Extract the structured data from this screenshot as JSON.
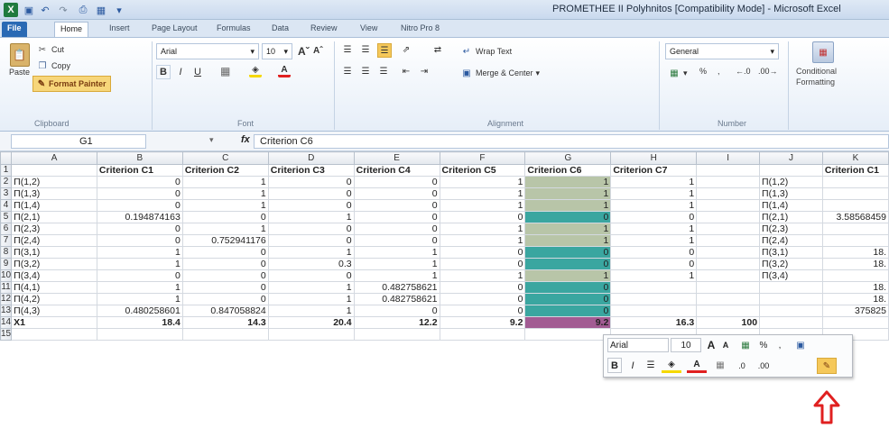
{
  "titlebar": {
    "title": "PROMETHEE II Polyhnitos  [Compatibility Mode] - Microsoft Excel",
    "excel_icon": "excel-icon",
    "save_icon": "save-icon",
    "undo_icon": "undo-icon",
    "redo_icon": "redo-icon",
    "print_icon": "print-icon"
  },
  "tabs": [
    "File",
    "Home",
    "Insert",
    "Page Layout",
    "Formulas",
    "Data",
    "Review",
    "View",
    "Nitro Pro 8"
  ],
  "ribbon": {
    "clipboard": {
      "paste": "Paste",
      "cut": "Cut",
      "copy": "Copy",
      "format_painter": "Format Painter",
      "label": "Clipboard"
    },
    "font": {
      "name": "Arial",
      "size": "10",
      "label": "Font",
      "bold": "B",
      "italic": "I",
      "underline": "U"
    },
    "alignment": {
      "wrap_text": "Wrap Text",
      "merge_center": "Merge & Center",
      "label": "Alignment"
    },
    "number": {
      "format": "General",
      "percent": "%",
      "label": "Number"
    },
    "styles": {
      "conditional": "Conditional",
      "formatting": "Formatting"
    }
  },
  "formula_bar": {
    "cell_ref": "G1",
    "fx": "fx",
    "content": "Criterion C6"
  },
  "grid": {
    "columns": [
      "A",
      "B",
      "C",
      "D",
      "E",
      "F",
      "G",
      "H",
      "I",
      "J",
      "K"
    ],
    "rows": [
      [
        "",
        "Criterion C1",
        "Criterion C2",
        "Criterion C3",
        "Criterion C4",
        "Criterion C5",
        "Criterion C6",
        "Criterion C7",
        "",
        "",
        "Criterion C1"
      ],
      [
        "Π(1,2)",
        "0",
        "1",
        "0",
        "0",
        "1",
        "1",
        "1",
        "",
        "Π(1,2)",
        ""
      ],
      [
        "Π(1,3)",
        "0",
        "1",
        "0",
        "0",
        "1",
        "1",
        "1",
        "",
        "Π(1,3)",
        ""
      ],
      [
        "Π(1,4)",
        "0",
        "1",
        "0",
        "0",
        "1",
        "1",
        "1",
        "",
        "Π(1,4)",
        ""
      ],
      [
        "Π(2,1)",
        "0.194874163",
        "0",
        "1",
        "0",
        "0",
        "0",
        "0",
        "",
        "Π(2,1)",
        "3.58568459"
      ],
      [
        "Π(2,3)",
        "0",
        "1",
        "0",
        "0",
        "1",
        "1",
        "1",
        "",
        "Π(2,3)",
        ""
      ],
      [
        "Π(2,4)",
        "0",
        "0.752941176",
        "0",
        "0",
        "1",
        "1",
        "1",
        "",
        "Π(2,4)",
        ""
      ],
      [
        "Π(3,1)",
        "1",
        "0",
        "1",
        "1",
        "0",
        "0",
        "0",
        "",
        "Π(3,1)",
        "18."
      ],
      [
        "Π(3,2)",
        "1",
        "0",
        "0.3",
        "1",
        "0",
        "0",
        "0",
        "",
        "Π(3,2)",
        "18."
      ],
      [
        "Π(3,4)",
        "0",
        "0",
        "0",
        "1",
        "1",
        "1",
        "1",
        "",
        "Π(3,4)",
        ""
      ],
      [
        "Π(4,1)",
        "1",
        "0",
        "1",
        "0.482758621",
        "0",
        "0",
        "",
        "",
        "",
        "18."
      ],
      [
        "Π(4,2)",
        "1",
        "0",
        "1",
        "0.482758621",
        "0",
        "0",
        "",
        "",
        "",
        "18."
      ],
      [
        "Π(4,3)",
        "0.480258601",
        "0.847058824",
        "1",
        "0",
        "0",
        "0",
        "",
        "",
        "",
        "375825"
      ],
      [
        "X1",
        "18.4",
        "14.3",
        "20.4",
        "12.2",
        "9.2",
        "9.2",
        "16.3",
        "100",
        "",
        ""
      ],
      [
        "",
        "",
        "",
        "",
        "",
        "",
        "",
        "",
        "",
        "",
        ""
      ]
    ],
    "row_numbers": [
      "1",
      "2",
      "3",
      "4",
      "5",
      "6",
      "7",
      "8",
      "9",
      "10",
      "11",
      "12",
      "13",
      "14",
      "15"
    ]
  },
  "mini_toolbar": {
    "font": "Arial",
    "size": "10",
    "bold": "B",
    "italic": "I",
    "percent": "%"
  },
  "colors": {
    "green_fill": "#b8c5a8",
    "teal_fill": "#3aa6a0",
    "purple_fill": "#a25c93",
    "red_arrow": "#e02020"
  }
}
